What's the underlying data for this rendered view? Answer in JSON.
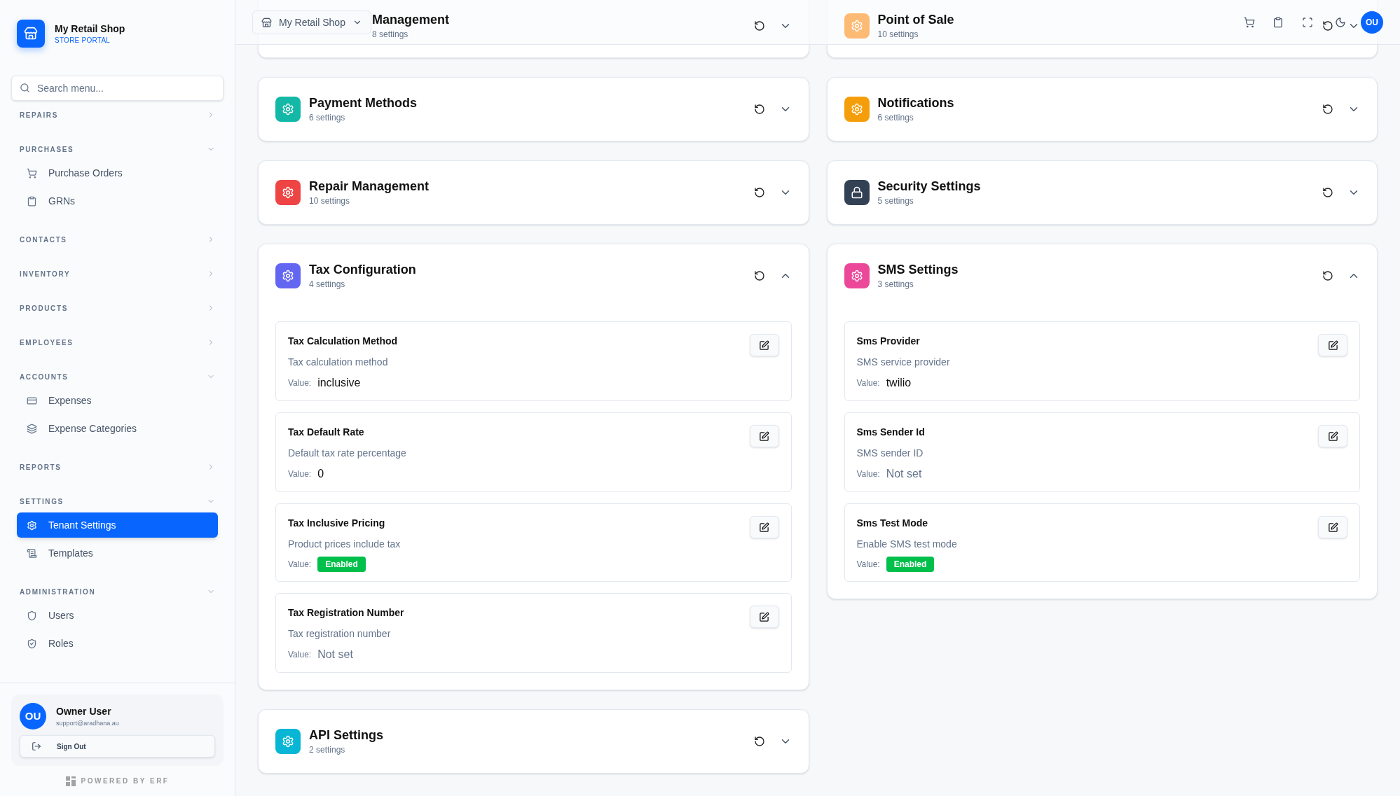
{
  "sidebar": {
    "brand": {
      "name": "My Retail Shop",
      "subtitle": "STORE PORTAL"
    },
    "search": {
      "placeholder": "Search menu..."
    },
    "sections": [
      {
        "label": "REPAIRS",
        "expanded": false
      },
      {
        "label": "PURCHASES",
        "expanded": true,
        "items": [
          {
            "label": "Purchase Orders",
            "selected": false
          },
          {
            "label": "GRNs",
            "selected": false
          }
        ]
      },
      {
        "label": "CONTACTS",
        "expanded": false
      },
      {
        "label": "INVENTORY",
        "expanded": false
      },
      {
        "label": "PRODUCTS",
        "expanded": false
      },
      {
        "label": "EMPLOYEES",
        "expanded": false
      },
      {
        "label": "ACCOUNTS",
        "expanded": true,
        "items": [
          {
            "label": "Expenses",
            "selected": false
          },
          {
            "label": "Expense Categories",
            "selected": false
          }
        ]
      },
      {
        "label": "REPORTS",
        "expanded": false
      },
      {
        "label": "SETTINGS",
        "expanded": true,
        "items": [
          {
            "label": "Tenant Settings",
            "selected": true
          },
          {
            "label": "Templates",
            "selected": false
          }
        ]
      },
      {
        "label": "ADMINISTRATION",
        "expanded": true,
        "items": [
          {
            "label": "Users",
            "selected": false
          },
          {
            "label": "Roles",
            "selected": false
          }
        ]
      }
    ],
    "user": {
      "initials": "OU",
      "name": "Owner User",
      "email": "support@aradhana.au",
      "sign_out": "Sign Out"
    },
    "footer": "POWERED BY ERF"
  },
  "header": {
    "store_selector": "My Retail Shop",
    "avatar": "OU"
  },
  "columns": [
    [
      {
        "kind": "partial",
        "title": "Management",
        "count": "8 settings",
        "expanded": false
      },
      {
        "kind": "full",
        "title": "Payment Methods",
        "count": "6 settings",
        "color": "#14b8a6",
        "expanded": false
      },
      {
        "kind": "full",
        "title": "Repair Management",
        "count": "10 settings",
        "color": "#ef4444",
        "expanded": false
      },
      {
        "kind": "full",
        "title": "Tax Configuration",
        "count": "4 settings",
        "color": "#6366f1",
        "expanded": true,
        "settings": [
          {
            "name": "Tax Calculation Method",
            "description": "Tax calculation method",
            "value_label": "Value:",
            "value": "inclusive",
            "kind": "text"
          },
          {
            "name": "Tax Default Rate",
            "description": "Default tax rate percentage",
            "value_label": "Value:",
            "value": "0",
            "kind": "text"
          },
          {
            "name": "Tax Inclusive Pricing",
            "description": "Product prices include tax",
            "value_label": "Value:",
            "value": "Enabled",
            "kind": "badge"
          },
          {
            "name": "Tax Registration Number",
            "description": "Tax registration number",
            "value_label": "Value:",
            "value": "Not set",
            "kind": "unset"
          }
        ]
      },
      {
        "kind": "full",
        "title": "API Settings",
        "count": "2 settings",
        "color": "#06b6d4",
        "expanded": false
      }
    ],
    [
      {
        "kind": "full",
        "title": "Point of Sale",
        "count": "10 settings",
        "color": "#fdba74",
        "expanded": false
      },
      {
        "kind": "full",
        "title": "Notifications",
        "count": "6 settings",
        "color": "#f59e0b",
        "expanded": false
      },
      {
        "kind": "full",
        "title": "Security Settings",
        "count": "5 settings",
        "color": "#334155",
        "expanded": false
      },
      {
        "kind": "full",
        "title": "SMS Settings",
        "count": "3 settings",
        "color": "#ec4899",
        "expanded": true,
        "settings": [
          {
            "name": "Sms Provider",
            "description": "SMS service provider",
            "value_label": "Value:",
            "value": "twilio",
            "kind": "text"
          },
          {
            "name": "Sms Sender Id",
            "description": "SMS sender ID",
            "value_label": "Value:",
            "value": "Not set",
            "kind": "unset"
          },
          {
            "name": "Sms Test Mode",
            "description": "Enable SMS test mode",
            "value_label": "Value:",
            "value": "Enabled",
            "kind": "badge"
          }
        ]
      }
    ]
  ]
}
